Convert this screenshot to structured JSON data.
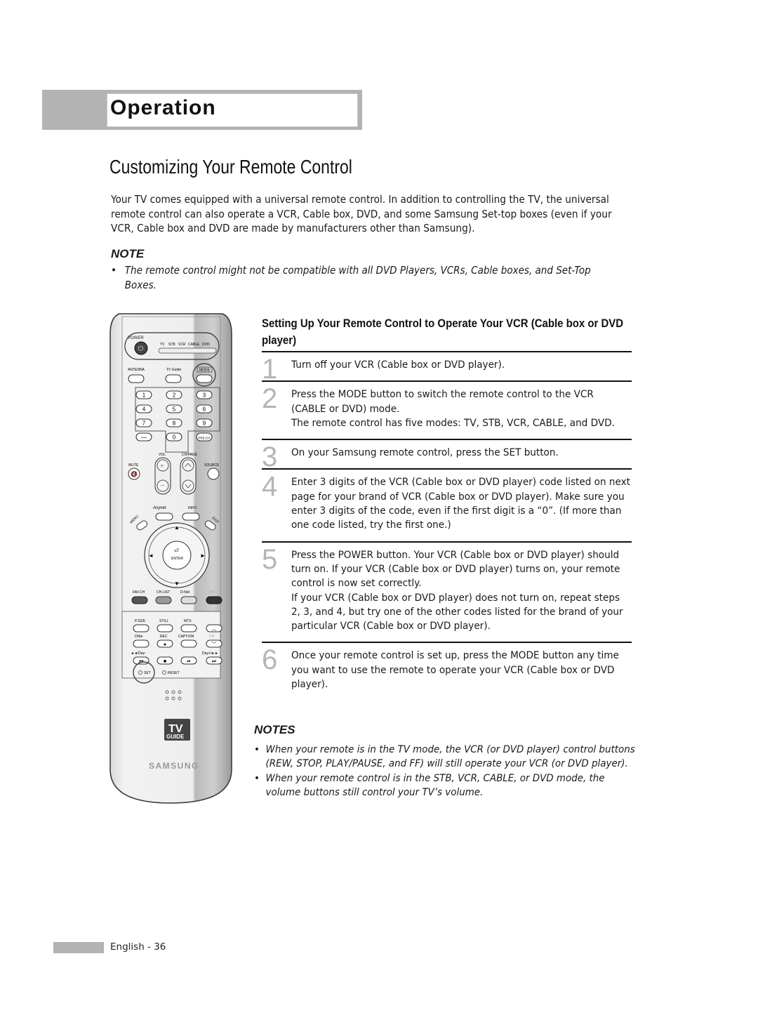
{
  "header": {
    "section_title": "Operation"
  },
  "page_title": "Customizing Your Remote Control",
  "intro": "Your TV comes equipped with a universal remote control. In addition to controlling the TV, the universal remote control can also operate a VCR, Cable box, DVD, and some Samsung Set-top boxes (even if your VCR, Cable box and DVD are made by manufacturers other than Samsung).",
  "note": {
    "heading": "NOTE",
    "items": [
      "The remote control might not be compatible with all DVD Players, VCRs, Cable boxes, and Set-Top Boxes."
    ]
  },
  "setup": {
    "title": "Setting Up Your Remote Control to Operate Your VCR (Cable box or DVD player)",
    "steps": [
      {
        "num": "1",
        "lines": [
          "Turn off your VCR (Cable box or DVD player)."
        ]
      },
      {
        "num": "2",
        "lines": [
          "Press the MODE button to switch the remote control to the VCR (CABLE or DVD) mode.",
          "The remote control has five modes: TV, STB, VCR, CABLE, and DVD."
        ]
      },
      {
        "num": "3",
        "lines": [
          "On your Samsung remote control, press the SET button."
        ]
      },
      {
        "num": "4",
        "lines": [
          "Enter 3 digits of the VCR (Cable box or DVD player) code listed on next page for your brand of VCR (Cable box or DVD player). Make sure you enter 3 digits of the code, even if the first digit is a “0”. (If more than one code listed, try the first one.)"
        ]
      },
      {
        "num": "5",
        "lines": [
          "Press the POWER button. Your VCR (Cable box or DVD player) should turn on. If your VCR (Cable box or DVD player) turns on, your remote control is now set correctly.",
          "If your VCR (Cable box or DVD player) does not turn on, repeat steps 2, 3, and 4, but try one of the other codes listed for the brand of your particular VCR (Cable box or DVD player)."
        ]
      },
      {
        "num": "6",
        "lines": [
          "Once your remote control is set up, press the MODE button any time you want to use the remote to operate your VCR (Cable box or DVD player)."
        ]
      }
    ]
  },
  "notes": {
    "heading": "NOTES",
    "items": [
      "When your remote is in the TV mode, the VCR (or DVD player) control buttons (REW, STOP, PLAY/PAUSE, and FF) will still operate your VCR (or DVD player).",
      "When your remote control is in the STB, VCR, CABLE, or DVD mode, the volume buttons still control your TV’s volume."
    ]
  },
  "remote": {
    "power": "POWER",
    "modes": [
      "TV",
      "STB",
      "VCR",
      "CABLE",
      "DVD"
    ],
    "antenna": "ANTENNA",
    "tv_guide": "TV Guide",
    "mode": "MODE",
    "digits": [
      "1",
      "2",
      "3",
      "4",
      "5",
      "6",
      "7",
      "8",
      "9",
      "—",
      "0",
      "PRE-CH"
    ],
    "vol": "VOL",
    "ch_page": "CH/PAGE",
    "mute": "MUTE",
    "source": "SOURCE",
    "anynet": "Anynet",
    "info": "INFO",
    "menu": "MENU",
    "exit": "EXIT",
    "enter": "ENTER",
    "color_row": [
      "FAV.CH",
      "CH.LIST",
      "D-Net",
      "PIP"
    ],
    "row1": [
      "P.SIZE",
      "STILL",
      "MTS"
    ],
    "row2": [
      "DNIe",
      "REC",
      "CAPTION",
      "CH"
    ],
    "rew_label": "◄◄/Day-",
    "ff_label": "Day+/►►",
    "set": "SET",
    "reset": "RESET",
    "tv_guide_logo_top": "TV",
    "tv_guide_logo_bottom": "GUIDE",
    "brand": "SAMSUNG"
  },
  "footer": {
    "page_label": "English - 36"
  }
}
